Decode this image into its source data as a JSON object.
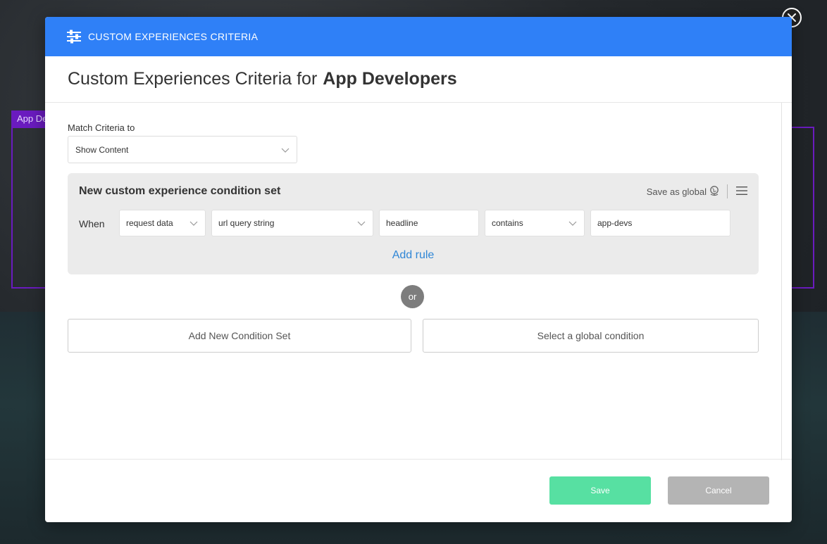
{
  "background": {
    "tag_label": "App De"
  },
  "header": {
    "icon": "sliders-icon",
    "title": "CUSTOM EXPERIENCES CRITERIA"
  },
  "title": {
    "prefix": "Custom Experiences Criteria for",
    "name": "App Developers"
  },
  "match": {
    "label": "Match Criteria to",
    "selected": "Show Content"
  },
  "condition_set": {
    "title": "New custom experience condition set",
    "save_global_label": "Save as global",
    "when_label": "When",
    "rules": [
      {
        "value": "request data",
        "type": "select"
      },
      {
        "value": "url query string",
        "type": "select"
      },
      {
        "value": "headline",
        "type": "input"
      },
      {
        "value": "contains",
        "type": "select"
      },
      {
        "value": "app-devs",
        "type": "input"
      }
    ],
    "add_rule_label": "Add rule"
  },
  "or_label": "or",
  "actions": {
    "add_condition_set": "Add New Condition Set",
    "select_global": "Select a global condition"
  },
  "footer": {
    "save_label": "Save",
    "cancel_label": "Cancel"
  },
  "colors": {
    "header_blue": "#2f80f7",
    "save_green": "#57e0a2",
    "cancel_gray": "#b4b4b4",
    "link_blue": "#2f86d6",
    "bg_purple": "#6a1bbf"
  }
}
